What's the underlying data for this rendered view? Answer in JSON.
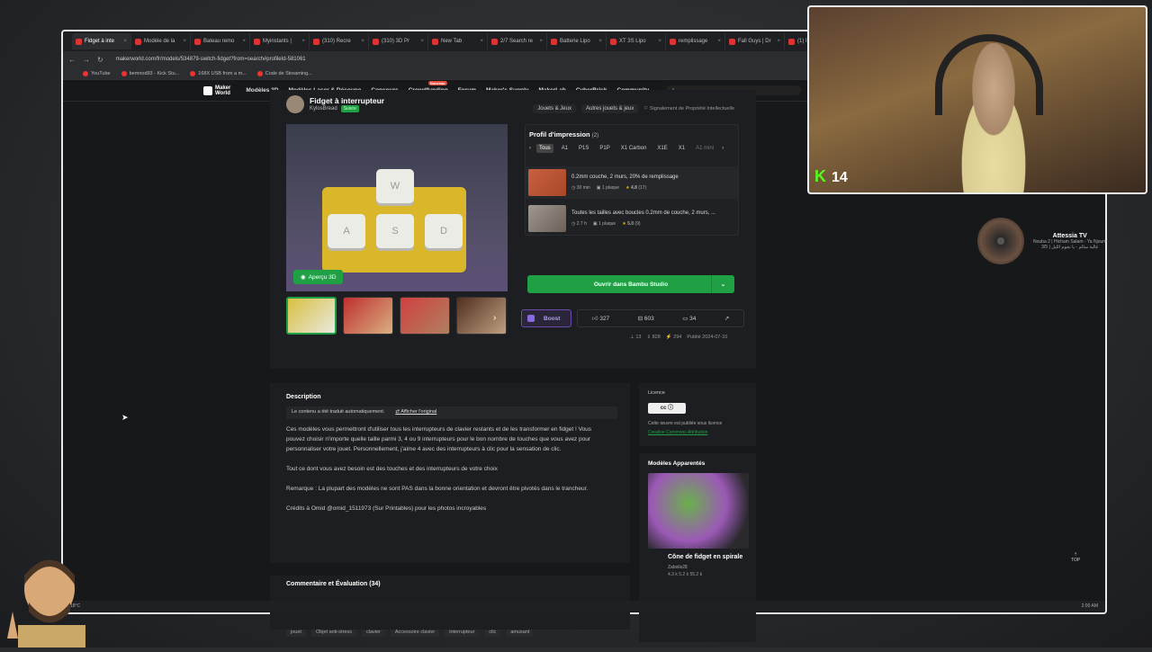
{
  "browser": {
    "tabs": [
      {
        "label": "Fidget à inte",
        "active": true
      },
      {
        "label": "Modèle de la"
      },
      {
        "label": "Bateau remo"
      },
      {
        "label": "Myinstants |"
      },
      {
        "label": "(310) Recre"
      },
      {
        "label": "(310) 3D Pr"
      },
      {
        "label": "New Tab"
      },
      {
        "label": "2/7 Search re"
      },
      {
        "label": "Batterie Lipo"
      },
      {
        "label": "XT 3S Lipo"
      },
      {
        "label": "remplissage"
      },
      {
        "label": "Fall Guys | Dr"
      },
      {
        "label": "(1) Inst"
      }
    ],
    "url": "makerworld.com/fr/models/534879-switch-fidget?from=search#profileId-581061",
    "bookmarks": [
      "YouTube",
      "bemnod93 - Kick Stu...",
      "168X USB from a m...",
      "Code de Streaming..."
    ]
  },
  "header": {
    "logo_line1": "Maker",
    "logo_line2": "World",
    "nav": [
      "Modèles 3D",
      "Modèles Laser & Découpe",
      "Concours",
      "Crowdfunding",
      "Forum",
      "Maker's Supply",
      "MakerLab",
      "CyberBrick",
      "Community"
    ],
    "new_badge": "Nouveau"
  },
  "model": {
    "title": "Fidget à interrupteur",
    "author": "KylosBread",
    "author_badge": "Suivre",
    "crumbs": [
      "Jouets & Jeux",
      "Autres jouets & jeux"
    ],
    "report": "Signalement de Propriété Intellectuelle",
    "preview_3d": "Aperçu 3D",
    "keys": [
      "W",
      "A",
      "S",
      "D"
    ]
  },
  "profile": {
    "title": "Profil d'impression",
    "count": "(2)",
    "tabs": [
      "Tous",
      "A1",
      "P1S",
      "P1P",
      "X1 Carbon",
      "X1E",
      "X1",
      "A1 mini"
    ],
    "rows": [
      {
        "name": "0.2mm couche, 2 murs, 20% de remplissage",
        "time": "30 min",
        "plates": "1 plaque",
        "rating": "4.8",
        "reviews": "(17)"
      },
      {
        "name": "Toutes les tailles avec boucles 0.2mm de couche, 2 murs, ...",
        "time": "2.7 h",
        "plates": "1 plaque",
        "rating": "5.0",
        "reviews": "(9)"
      }
    ],
    "open_button": "Ouvrir dans Bambu Studio"
  },
  "actions": {
    "boost": "Boost",
    "likes": "327",
    "collects": "603",
    "comments": "34"
  },
  "stats": {
    "prints": "13",
    "downloads": "828",
    "boosts": "294",
    "published": "Publié 2024-07-10"
  },
  "description": {
    "heading": "Description",
    "auto_note": "Le contenu a été traduit automatiquement.",
    "show_original": "Afficher l'original",
    "p1": "Ces modèles vous permettront d'utiliser tous les interrupteurs de clavier restants et de les transformer en fidget ! Vous pouvez choisir n'importe quelle taille parmi 3, 4 ou 9 interrupteurs pour le bon nombre de touches que vous avez pour personnaliser votre jouet. Personnellement, j'aime 4 avec des interrupteurs à clic pour la sensation de clic.",
    "p2": "Tout ce dont vous avez besoin est des touches et des interrupteurs de votre choix",
    "p3": "Remarque : La plupart des modèles ne sont PAS dans la bonne orientation et devront être pivotés dans le trancheur.",
    "p4": "Crédits à Omid @omid_1511973 (Sur Printables) pour les photos incroyables",
    "tags": [
      "jouet",
      "Objet anti-stress",
      "clavier",
      "Accessoire clavier",
      "interrupteur",
      "clic",
      "amusant"
    ]
  },
  "comments": {
    "heading": "Commentaire et Évaluation (34)"
  },
  "license": {
    "heading": "Licence",
    "badge": "cc ⓘ",
    "desc": "Cette œuvre est publiée sous licence",
    "link": "Creative Commons Attribution"
  },
  "related": {
    "heading": "Modèles Apparentés",
    "title": "Cône de fidget en spirale",
    "author": "Zabolis28",
    "stats": "4.3 k   5.2 k   55.2 k"
  },
  "top_label": "TOP",
  "taskbar": {
    "left": "18°C",
    "right": "2:00 AM"
  },
  "overlay": {
    "kick_logo": "K",
    "kick_count": "14",
    "music_title": "Attessia TV",
    "music_sub": "Nouba 2 | Hicham Salam - Ya Njoum",
    "music_sub2": "غالية سالم - يا نجوم الليل | 3/5"
  }
}
